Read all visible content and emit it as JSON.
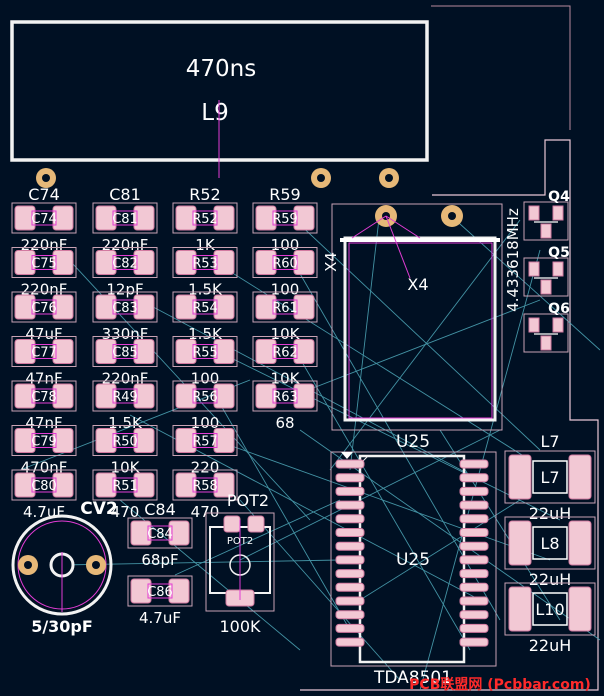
{
  "colors": {
    "background": "#001023",
    "outline": "#f2f2f2",
    "pad_fill": "#f2c8d4",
    "pad_border": "#d27aa0",
    "ratsnest": "#4fa9ba",
    "fab": "#e23cd4",
    "silk": "#ffffff",
    "through_pad": "#e6b878",
    "brand": "#ff2a2a",
    "board_edge": "#e8c7d6"
  },
  "large_part": {
    "value": "470ns",
    "reference": "L9"
  },
  "crystal": {
    "reference": "X4",
    "fab_label": "X4",
    "value": "4.433618MHz"
  },
  "ic": {
    "reference": "U25",
    "fab_label": "U25",
    "value": "TDA8501"
  },
  "small_parts": {
    "top": "Q4",
    "middle": "Q5",
    "bottom": "Q6"
  },
  "trimmer_cap": {
    "reference": "CV2",
    "value": "5/30pF"
  },
  "pot": {
    "reference": "POT2",
    "fab_label": "POT2",
    "value": "100K"
  },
  "caps_column1": [
    {
      "ref": "C74",
      "val": "220nF"
    },
    {
      "ref": "C75",
      "val": "220nF"
    },
    {
      "ref": "C76",
      "val": "47uF"
    },
    {
      "ref": "C77",
      "val": "47nF"
    },
    {
      "ref": "C78",
      "val": "47nF"
    },
    {
      "ref": "C79",
      "val": "470nF"
    },
    {
      "ref": "C80",
      "val": "4.7uF"
    }
  ],
  "caps_column2": [
    {
      "ref": "C81",
      "val": "220nF"
    },
    {
      "ref": "C82",
      "val": "12pF"
    },
    {
      "ref": "C83",
      "val": "330nF"
    },
    {
      "ref": "C85",
      "val": "220nF"
    },
    {
      "ref": "R49",
      "val": "1.5K"
    },
    {
      "ref": "R50",
      "val": "10K"
    },
    {
      "ref": "R51",
      "val": "470"
    }
  ],
  "res_column3": [
    {
      "ref": "R52",
      "val": "1K"
    },
    {
      "ref": "R53",
      "val": "1.5K"
    },
    {
      "ref": "R54",
      "val": "1.5K"
    },
    {
      "ref": "R55",
      "val": "100"
    },
    {
      "ref": "R56",
      "val": "100"
    },
    {
      "ref": "R57",
      "val": "220"
    },
    {
      "ref": "R58",
      "val": "470"
    }
  ],
  "res_column4": [
    {
      "ref": "R59",
      "val": "100"
    },
    {
      "ref": "R60",
      "val": "100"
    },
    {
      "ref": "R61",
      "val": "10K"
    },
    {
      "ref": "R62",
      "val": "10K"
    },
    {
      "ref": "R63",
      "val": "68"
    }
  ],
  "caps_pair": {
    "top_ref": "C84",
    "top_val": "68pF",
    "bottom_ref": "C86",
    "bottom_val": "4.7uF"
  },
  "inductors": [
    {
      "ref": "L7",
      "val": "22uH"
    },
    {
      "ref": "L8",
      "val": "22uH"
    },
    {
      "ref": "L10",
      "val": "22uH"
    }
  ],
  "watermark": "PCB联盟网 (Pcbbar.com)"
}
